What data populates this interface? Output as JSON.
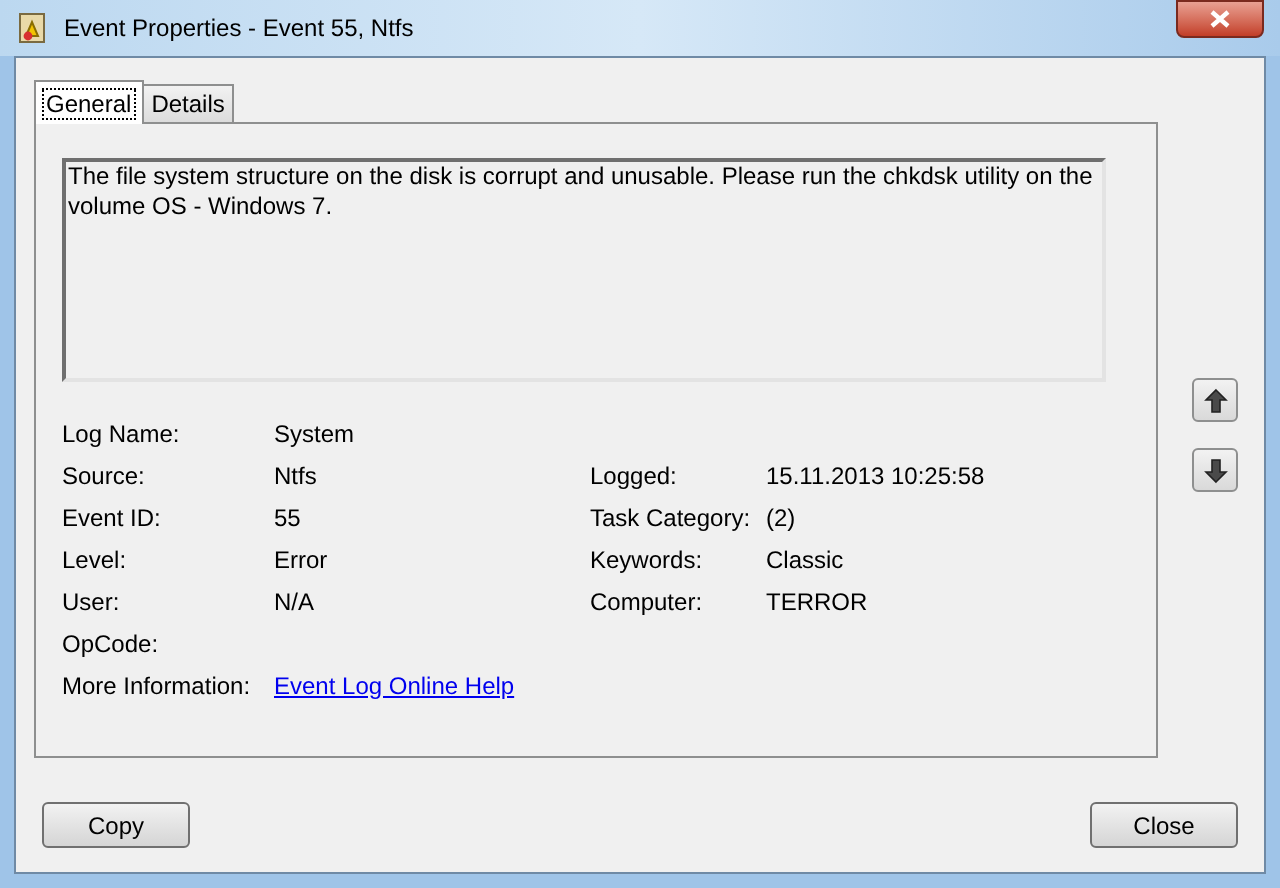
{
  "window": {
    "title": "Event Properties - Event 55, Ntfs"
  },
  "tabs": [
    {
      "label": "General",
      "selected": true
    },
    {
      "label": "Details",
      "selected": false
    }
  ],
  "description": "The file system structure on the disk is corrupt and unusable. Please run the chkdsk utility on the volume OS - Windows 7.",
  "fields_left": [
    {
      "label": "Log Name:",
      "value": "System"
    },
    {
      "label": "Source:",
      "value": "Ntfs"
    },
    {
      "label": "Event ID:",
      "value": "55"
    },
    {
      "label": "Level:",
      "value": "Error"
    },
    {
      "label": "User:",
      "value": "N/A"
    },
    {
      "label": "OpCode:"
    }
  ],
  "fields_right": [
    {
      "label": "Logged:",
      "value": "15.11.2013 10:25:58"
    },
    {
      "label": "Task Category:",
      "value": "(2)"
    },
    {
      "label": "Keywords:",
      "value": "Classic"
    },
    {
      "label": "Computer:",
      "value": "TERROR"
    }
  ],
  "more_information": {
    "label": "More Information:",
    "link": "Event Log Online Help"
  },
  "buttons": [
    "Copy",
    "Close"
  ]
}
